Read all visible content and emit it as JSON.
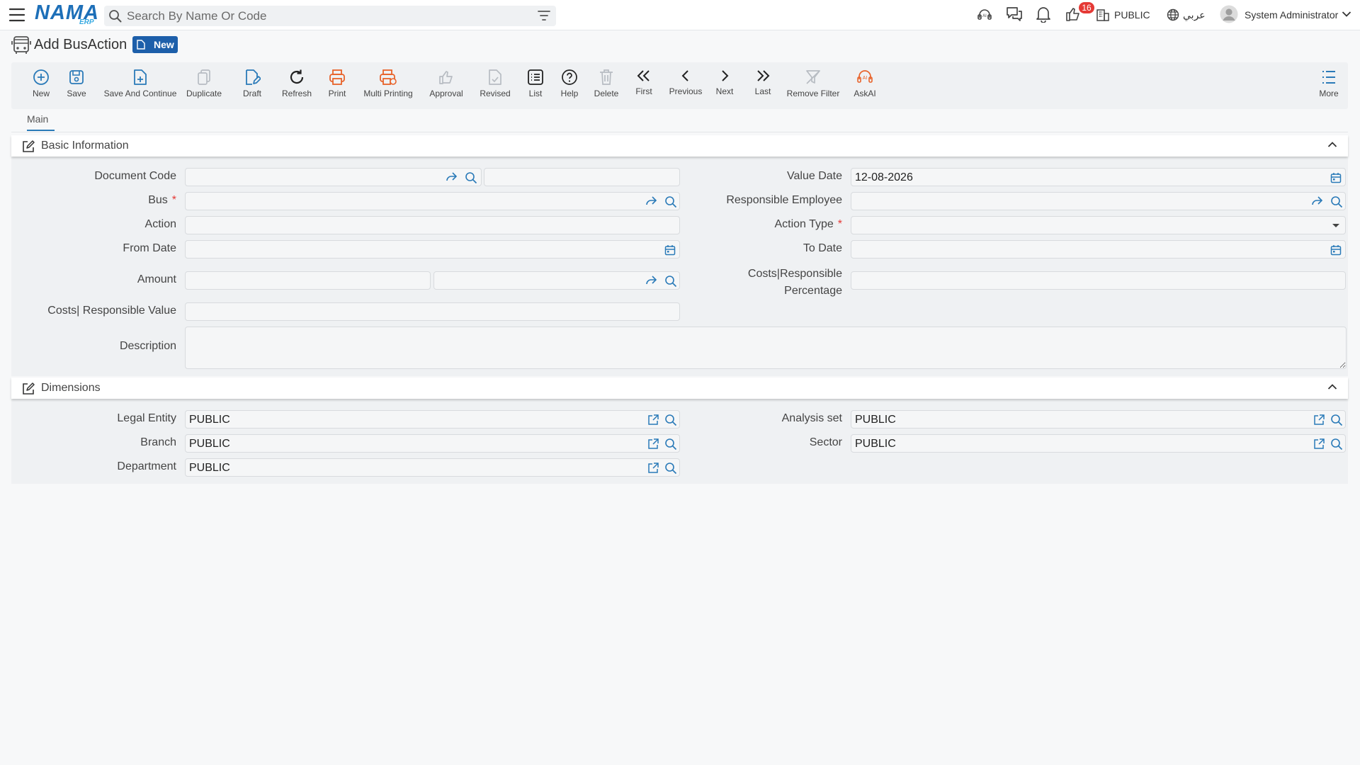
{
  "app": {
    "logo_main": "NAMA",
    "logo_sub": "ERP",
    "search_placeholder": "Search By Name Or Code",
    "notification_count": "16",
    "company": "PUBLIC",
    "language": "عربي",
    "user": "System Administrator"
  },
  "page": {
    "title": "Add BusAction",
    "status_badge": "New"
  },
  "toolbar": {
    "new": "New",
    "save": "Save",
    "save_continue": "Save And Continue",
    "duplicate": "Duplicate",
    "draft": "Draft",
    "refresh": "Refresh",
    "print": "Print",
    "multi_printing": "Multi Printing",
    "approval": "Approval",
    "revised": "Revised",
    "list": "List",
    "help": "Help",
    "delete": "Delete",
    "first": "First",
    "previous": "Previous",
    "next": "Next",
    "last": "Last",
    "remove_filter": "Remove Filter",
    "askai": "AskAI",
    "more": "More"
  },
  "tabs": [
    "Main"
  ],
  "basic_info": {
    "title": "Basic Information",
    "labels": {
      "document_code": "Document Code",
      "bus": "Bus",
      "action": "Action",
      "from_date": "From Date",
      "amount": "Amount",
      "costs_responsible_value": "Costs| Responsible Value",
      "description": "Description",
      "value_date": "Value Date",
      "responsible_employee": "Responsible Employee",
      "action_type": "Action Type",
      "to_date": "To Date",
      "costs_responsible_percentage_1": "Costs|Responsible",
      "costs_responsible_percentage_2": "Percentage"
    },
    "values": {
      "value_date": "12-08-2026"
    }
  },
  "dimensions": {
    "title": "Dimensions",
    "labels": {
      "legal_entity": "Legal Entity",
      "branch": "Branch",
      "department": "Department",
      "analysis_set": "Analysis set",
      "sector": "Sector"
    },
    "values": {
      "legal_entity": "PUBLIC",
      "branch": "PUBLIC",
      "department": "PUBLIC",
      "analysis_set": "PUBLIC",
      "sector": "PUBLIC"
    }
  },
  "colors": {
    "accent": "#1d5faa",
    "icon_blue": "#2a7ab8",
    "print_orange": "#e8632a",
    "badge_red": "#e53935",
    "required_red": "#e53935"
  }
}
